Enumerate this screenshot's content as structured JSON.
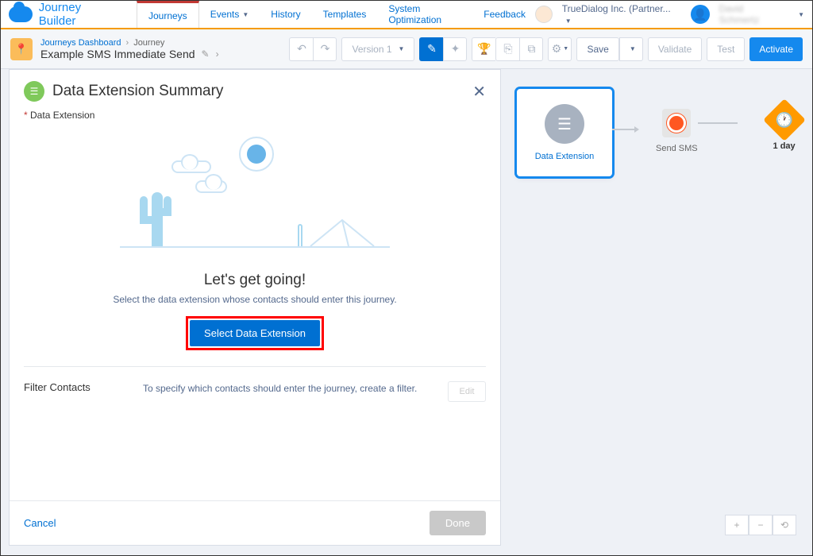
{
  "topbar": {
    "app_title": "Journey Builder",
    "tabs": [
      "Journeys",
      "Events",
      "History",
      "Templates",
      "System Optimization"
    ],
    "feedback": "Feedback",
    "org": "TrueDialog Inc. (Partner...",
    "user": "David Schmertz"
  },
  "toolbar": {
    "breadcrumb_root": "Journeys Dashboard",
    "breadcrumb_current": "Journey",
    "journey_name": "Example SMS Immediate Send",
    "version_label": "Version 1",
    "save": "Save",
    "validate": "Validate",
    "test": "Test",
    "activate": "Activate"
  },
  "canvas": {
    "node1_label": "Data Extension",
    "node2_label": "Send SMS",
    "node3_label": "1 day"
  },
  "panel": {
    "title": "Data Extension Summary",
    "section_label": "Data Extension",
    "cta_heading": "Let's get going!",
    "cta_sub": "Select the data extension whose contacts should enter this journey.",
    "cta_button": "Select Data Extension",
    "filter_label": "Filter Contacts",
    "filter_desc": "To specify which contacts should enter the journey, create a filter.",
    "filter_edit": "Edit",
    "cancel": "Cancel",
    "done": "Done"
  }
}
